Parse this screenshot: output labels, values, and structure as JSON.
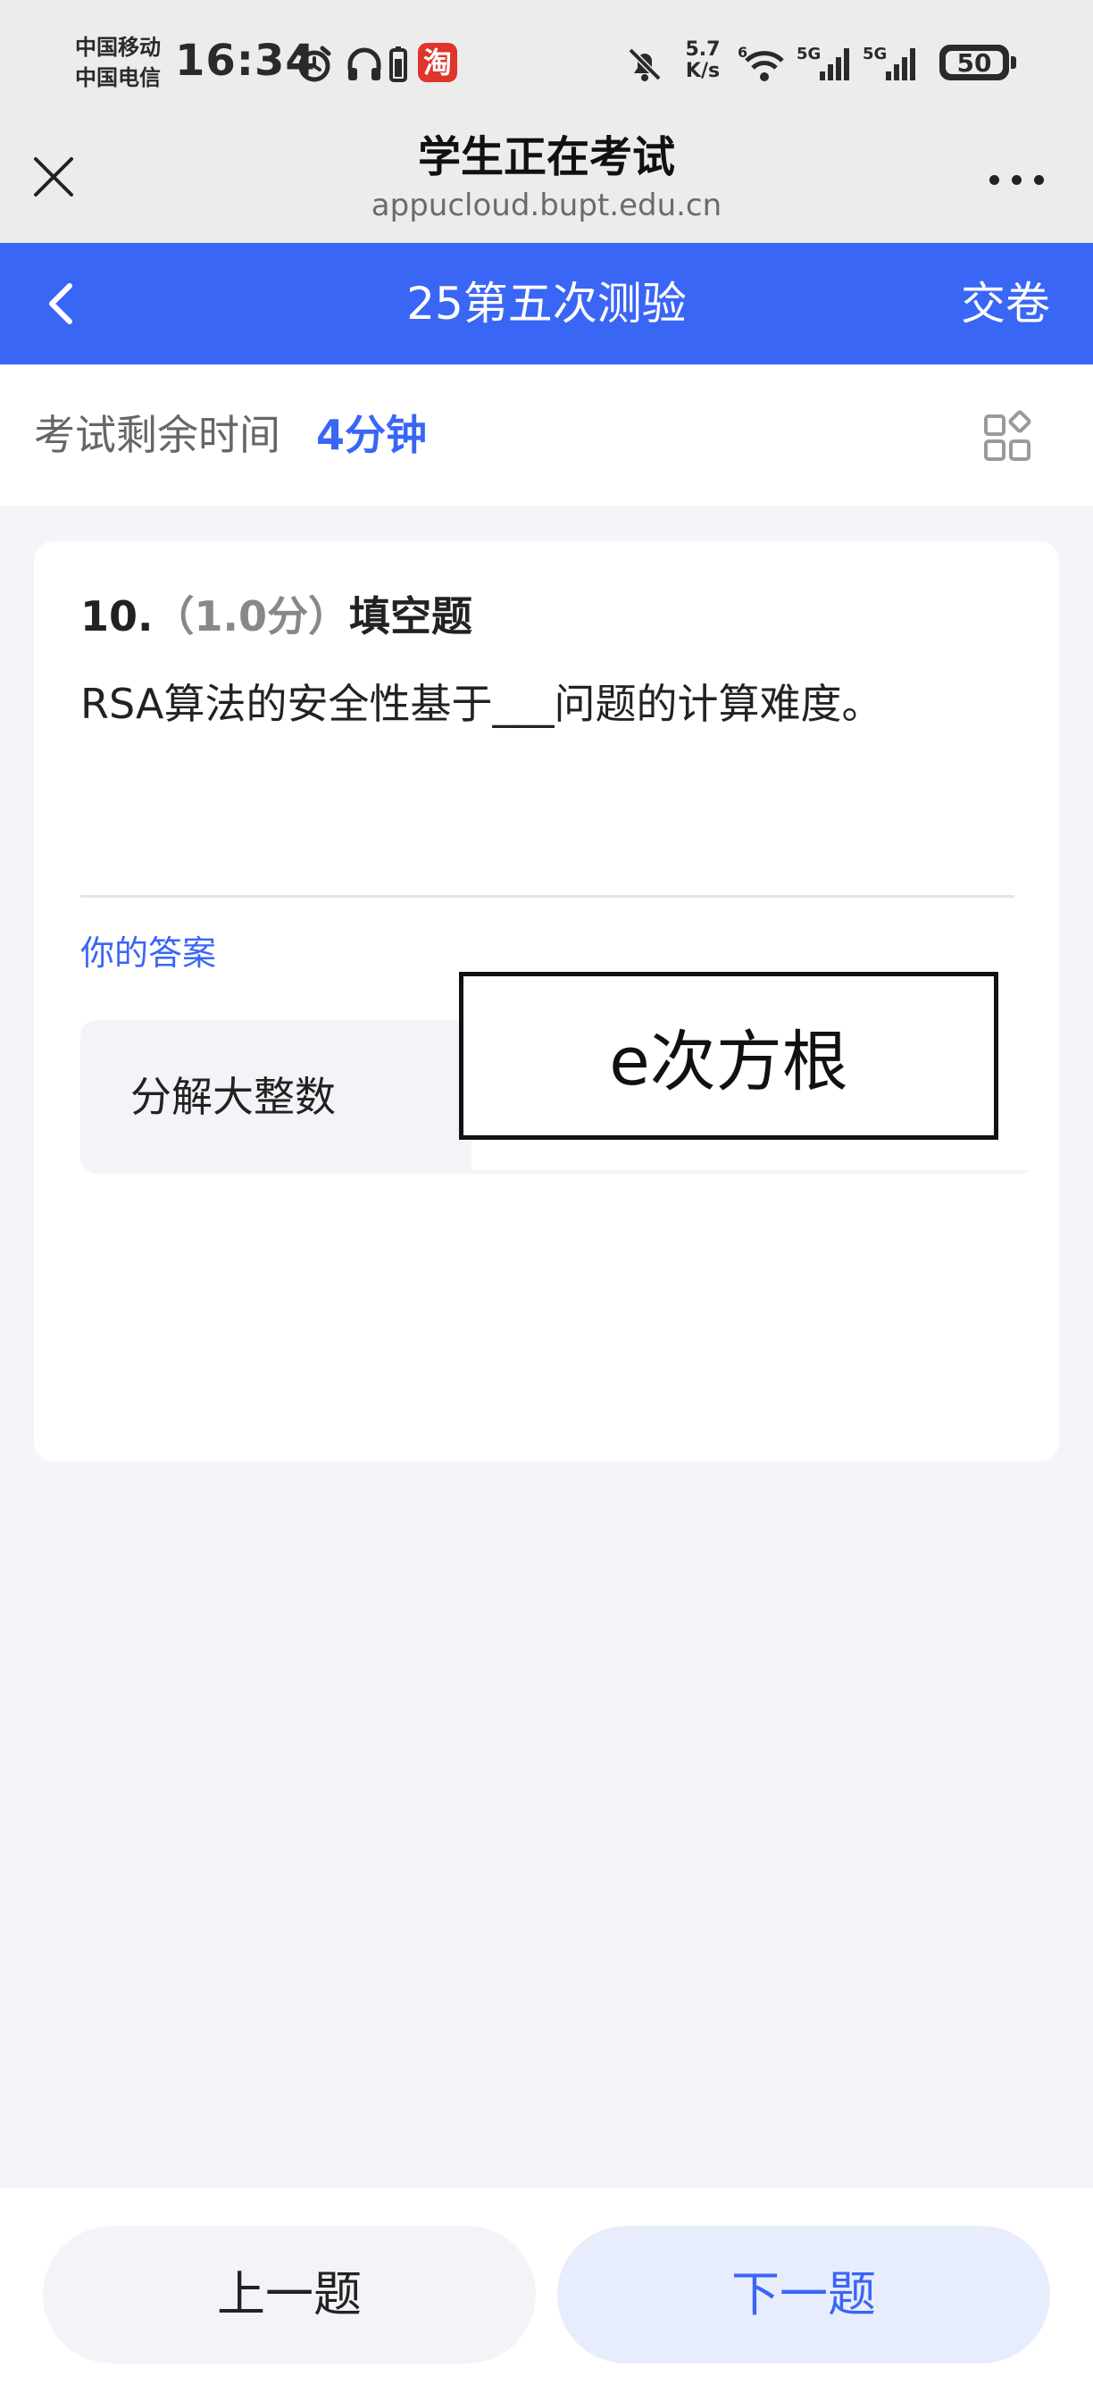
{
  "status_bar": {
    "carrier_1": "中国移动",
    "carrier_2": "中国电信",
    "time": "16:34",
    "net_speed_value": "5.7",
    "net_speed_unit": "K/s",
    "sim_1_label": "5G",
    "sim_2_label": "5G",
    "wifi_badge": "6",
    "battery_level": "50",
    "app_badge": "淘",
    "icons": [
      "alarm-icon",
      "headphones-icon",
      "battery-small-icon",
      "taobao-icon",
      "mute-bell-icon",
      "wifi-icon",
      "signal-icon",
      "signal-icon",
      "battery-icon"
    ]
  },
  "browser": {
    "title": "学生正在考试",
    "url": "appucloud.bupt.edu.cn",
    "close_icon": "close-icon",
    "more_icon": "more-icon"
  },
  "app_nav": {
    "back_icon": "chevron-left-icon",
    "title": "25第五次测验",
    "submit_label": "交卷"
  },
  "timer": {
    "label": "考试剩余时间",
    "value": "4分钟",
    "grid_icon": "question-grid-icon"
  },
  "question": {
    "number": "10.",
    "score": "（1.0分）",
    "type": "填空题",
    "text": "RSA算法的安全性基于___问题的计算难度。",
    "answer_label": "你的答案",
    "answer_value": "分解大整数",
    "overlay_text": "e次方根"
  },
  "footer": {
    "prev_label": "上一题",
    "next_label": "下一题"
  },
  "colors": {
    "accent": "#3a66f5",
    "page_bg": "#f4f5f9",
    "status_bg": "#ececec"
  }
}
